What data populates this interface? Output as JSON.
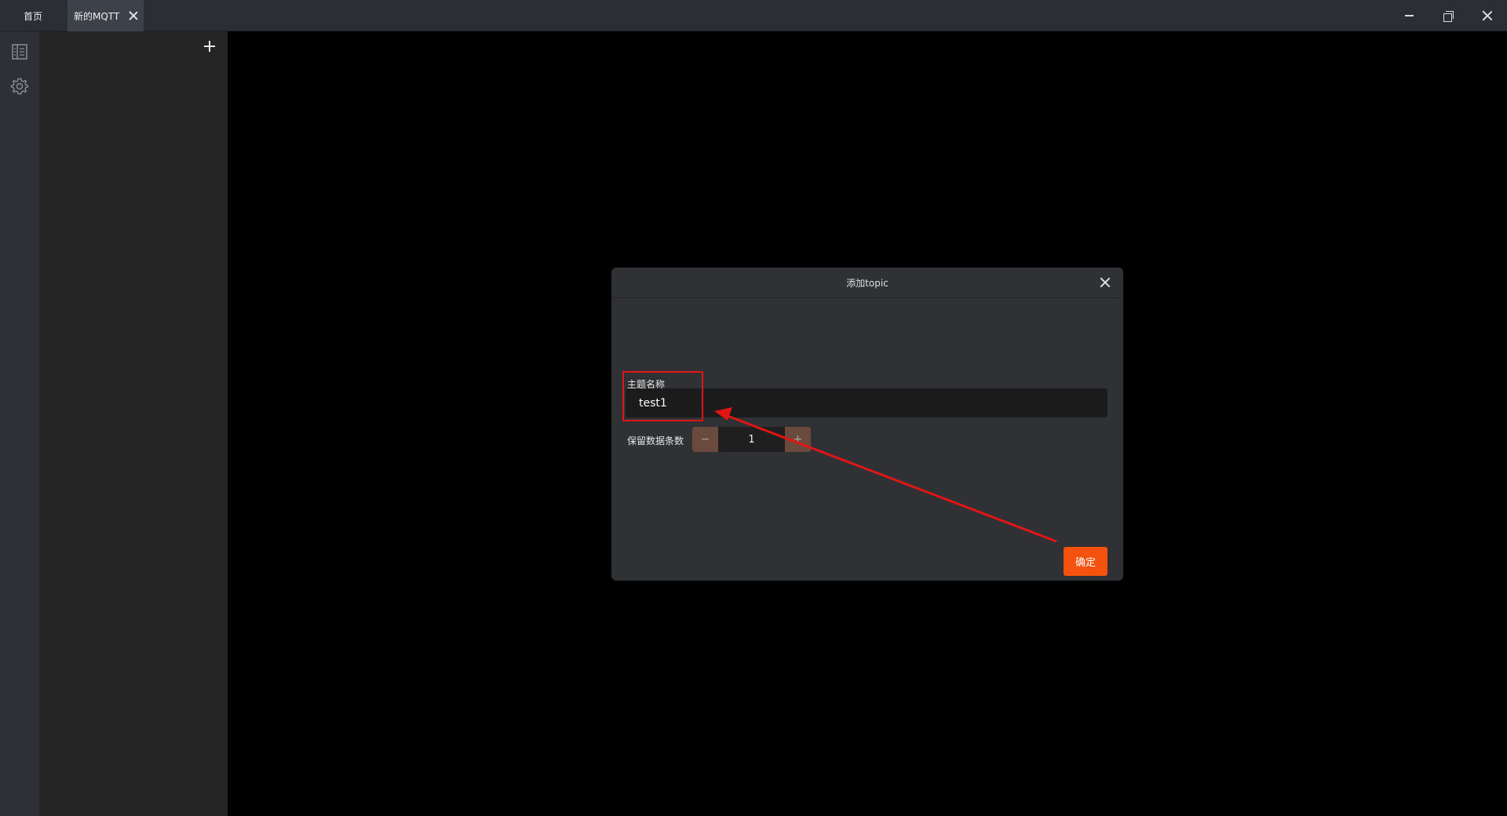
{
  "tabs": [
    {
      "label": "首页"
    },
    {
      "label": "新的MQTT"
    }
  ],
  "window_controls": {
    "minimize_icon": "minimize-icon",
    "maximize_icon": "restore-icon",
    "close_icon": "close-icon"
  },
  "rail": {
    "items": [
      {
        "icon": "book-icon"
      },
      {
        "icon": "gear-icon"
      }
    ]
  },
  "sidebar": {
    "add_icon": "plus-icon"
  },
  "dialog": {
    "title": "添加topic",
    "topic_label": "主题名称",
    "topic_value": "test1",
    "keep_label": "保留数据条数",
    "keep_value": "1",
    "minus_glyph": "−",
    "plus_glyph": "+",
    "confirm_label": "确定"
  },
  "colors": {
    "accent": "#f5520f",
    "annotation": "#e01515",
    "stepper_button": "#6a4a3c"
  }
}
